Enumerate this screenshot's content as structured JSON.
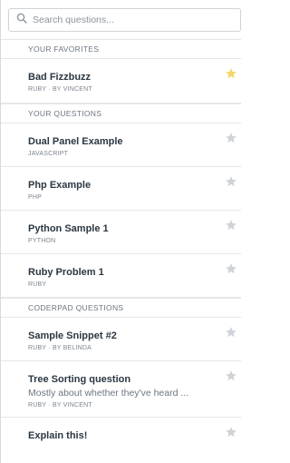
{
  "search": {
    "placeholder": "Search questions..."
  },
  "colors": {
    "star_favorite": "#f5d66a",
    "star_default": "#cfd3d8"
  },
  "sections": {
    "favorites": {
      "header": "YOUR FAVORITES",
      "items": [
        {
          "title": "Bad Fizzbuzz",
          "meta": "RUBY · BY VINCENT",
          "favorite": true
        }
      ]
    },
    "yours": {
      "header": "YOUR QUESTIONS",
      "items": [
        {
          "title": "Dual Panel Example",
          "meta": "JAVASCRIPT"
        },
        {
          "title": "Php Example",
          "meta": "PHP"
        },
        {
          "title": "Python Sample 1",
          "meta": "PYTHON"
        },
        {
          "title": "Ruby Problem 1",
          "meta": "RUBY"
        }
      ]
    },
    "coderpad": {
      "header": "CODERPAD QUESTIONS",
      "items": [
        {
          "title": "Sample Snippet #2",
          "meta": "RUBY · BY BELINDA"
        },
        {
          "title": "Tree Sorting question",
          "desc": "Mostly about whether they've heard ...",
          "meta": "RUBY · BY VINCENT"
        },
        {
          "title": "Explain this!"
        }
      ]
    }
  }
}
